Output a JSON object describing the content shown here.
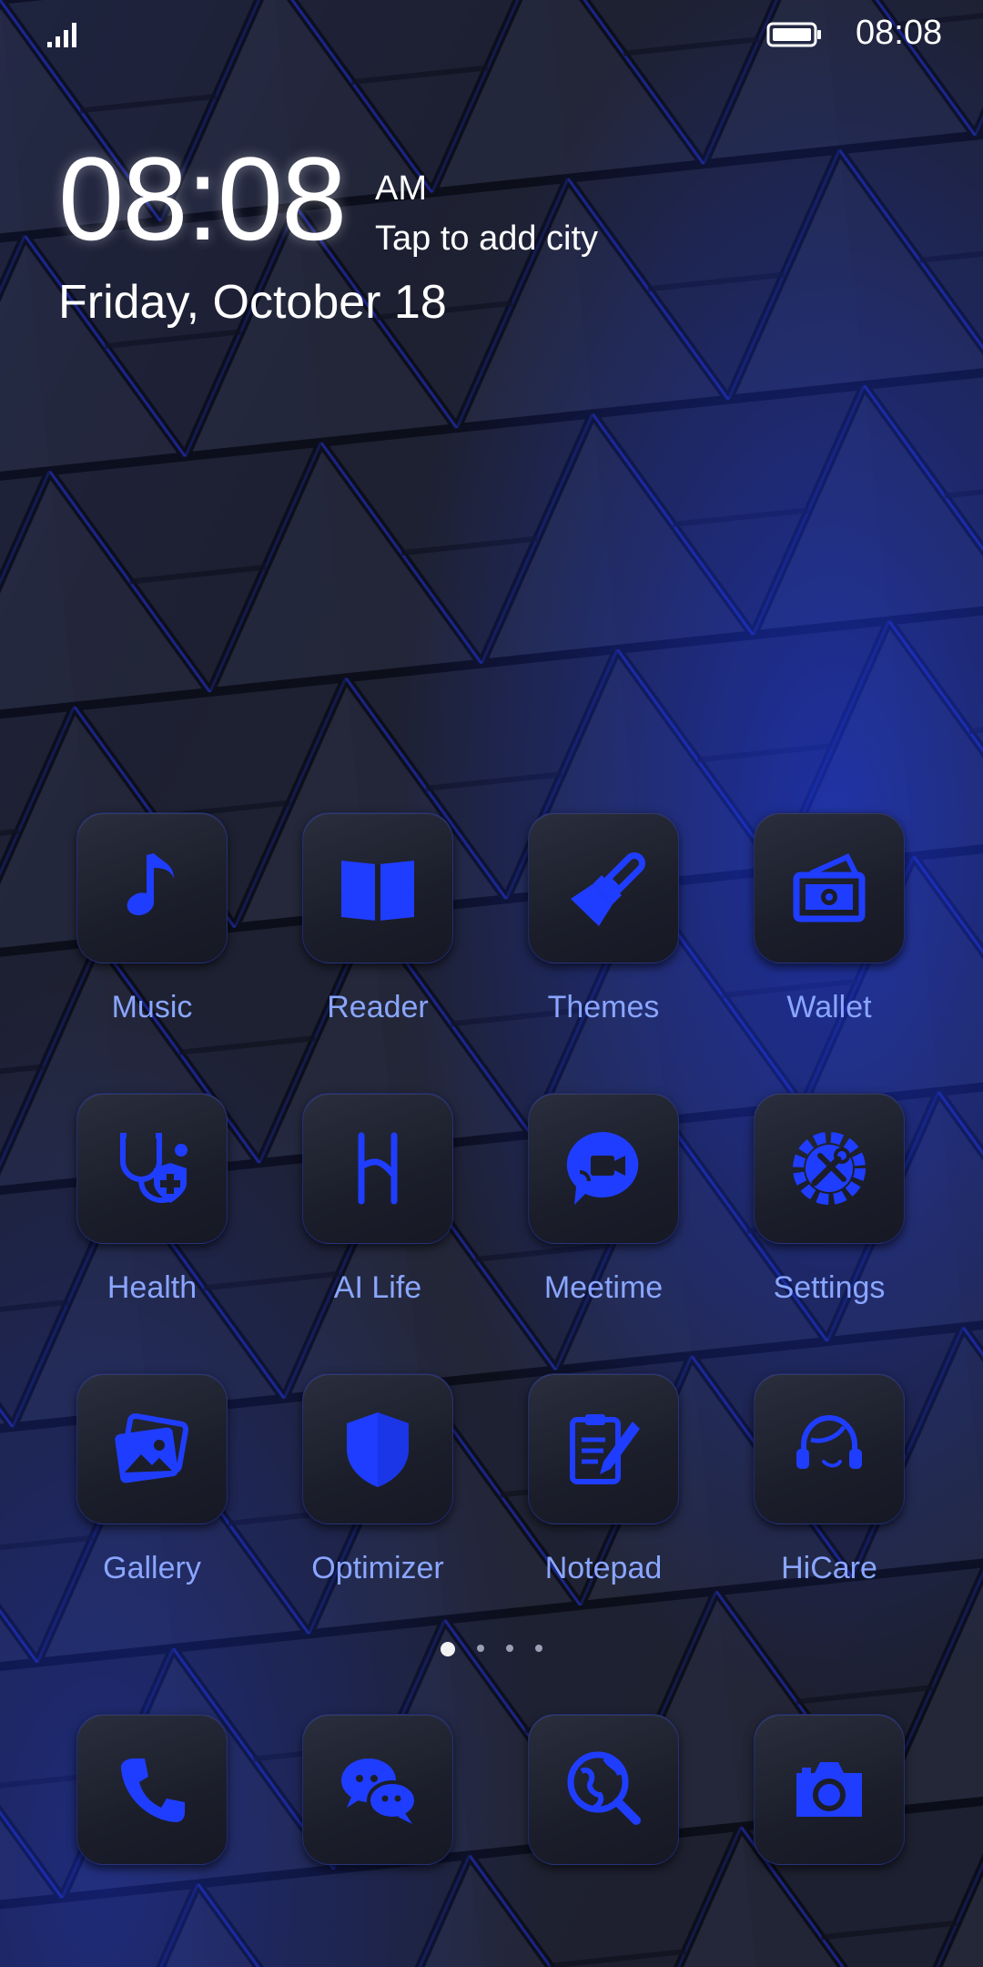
{
  "status_bar": {
    "time": "08:08"
  },
  "clock": {
    "time": "08:08",
    "ampm": "AM",
    "city_prompt": "Tap to add city",
    "date": "Friday, October 18"
  },
  "apps": [
    {
      "label": "Music",
      "icon": "music-note-icon"
    },
    {
      "label": "Reader",
      "icon": "book-icon"
    },
    {
      "label": "Themes",
      "icon": "paintbrush-icon"
    },
    {
      "label": "Wallet",
      "icon": "wallet-icon"
    },
    {
      "label": "Health",
      "icon": "stethoscope-icon"
    },
    {
      "label": "AI Life",
      "icon": "ai-life-icon"
    },
    {
      "label": "Meetime",
      "icon": "video-chat-icon"
    },
    {
      "label": "Settings",
      "icon": "gear-tools-icon"
    },
    {
      "label": "Gallery",
      "icon": "gallery-icon"
    },
    {
      "label": "Optimizer",
      "icon": "shield-icon"
    },
    {
      "label": "Notepad",
      "icon": "notepad-icon"
    },
    {
      "label": "HiCare",
      "icon": "headset-icon"
    }
  ],
  "dock": [
    {
      "icon": "phone-icon"
    },
    {
      "icon": "chat-bubbles-icon"
    },
    {
      "icon": "globe-search-icon"
    },
    {
      "icon": "camera-icon"
    }
  ],
  "pages": {
    "count": 4,
    "current": 1
  },
  "colors": {
    "accent": "#1f3dff",
    "label": "#8aa6ff",
    "tile": "#1e2130"
  }
}
